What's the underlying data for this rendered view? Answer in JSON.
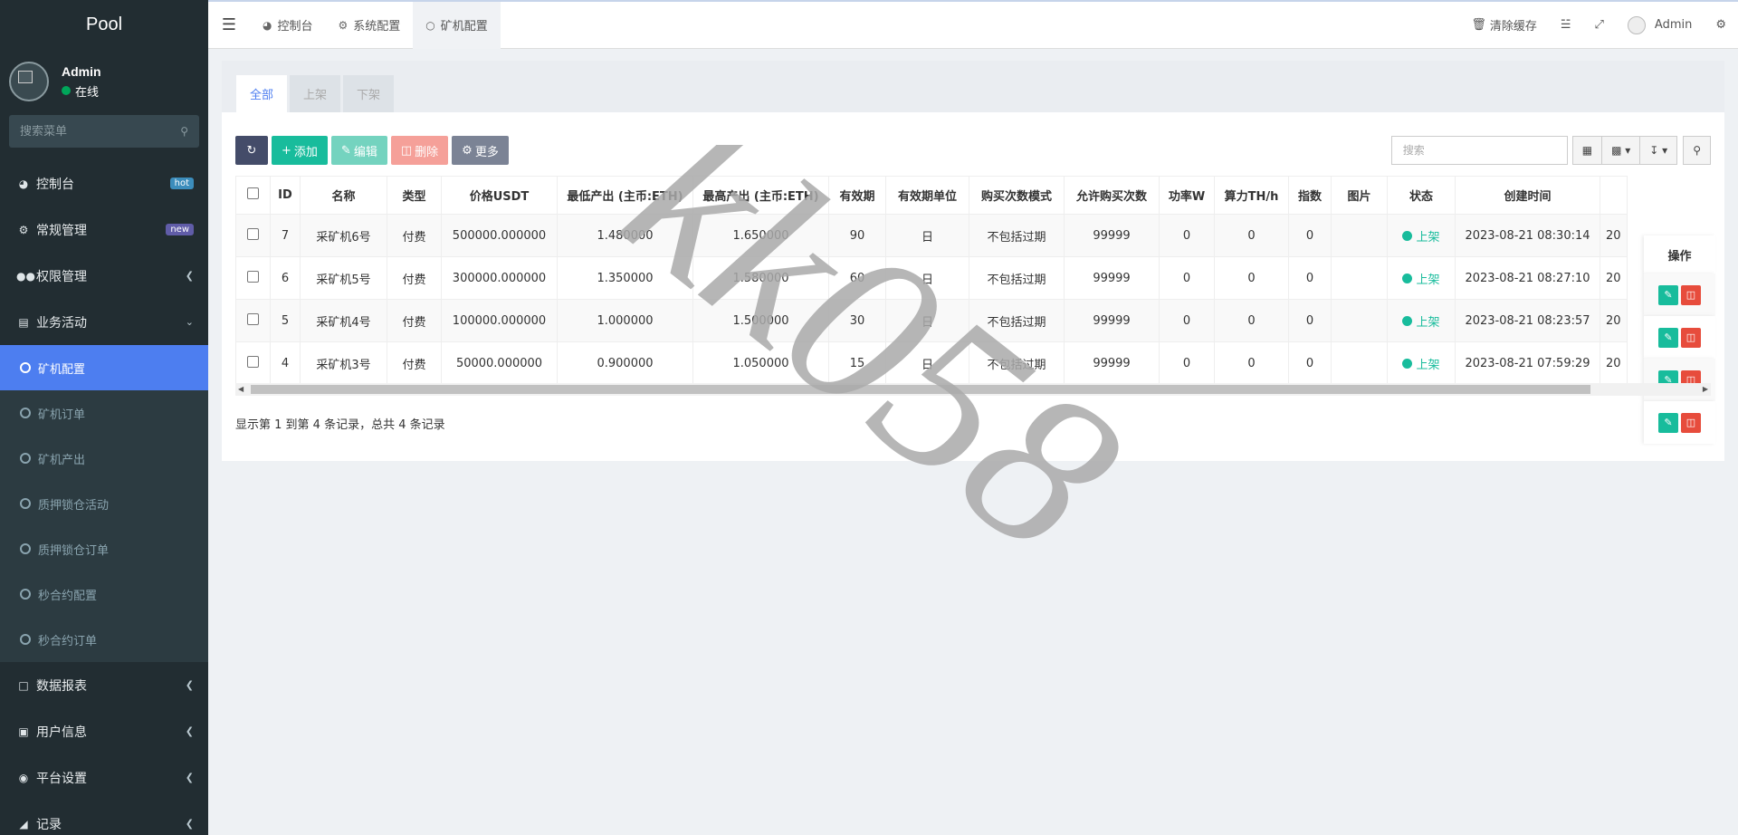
{
  "sidebar": {
    "logo": "Pool",
    "user": {
      "name": "Admin",
      "status": "在线"
    },
    "search_placeholder": "搜索菜单",
    "items": [
      {
        "label": "控制台",
        "badge": "hot",
        "icon": "dashboard-icon"
      },
      {
        "label": "常规管理",
        "badge": "new",
        "icon": "cogs-icon"
      },
      {
        "label": "权限管理",
        "icon": "group-icon"
      },
      {
        "label": "业务活动",
        "icon": "list-alt-icon"
      }
    ],
    "sub_items": [
      "矿机配置",
      "矿机订单",
      "矿机产出",
      "质押锁仓活动",
      "质押锁仓订单",
      "秒合约配置",
      "秒合约订单"
    ],
    "bottom_items": [
      {
        "label": "数据报表",
        "icon": "file-icon"
      },
      {
        "label": "用户信息",
        "icon": "user-card-icon"
      },
      {
        "label": "平台设置",
        "icon": "dot-circle-icon"
      },
      {
        "label": "记录",
        "icon": "area-chart-icon"
      }
    ]
  },
  "header": {
    "tabs": [
      {
        "label": "控制台",
        "icon": "dashboard-icon"
      },
      {
        "label": "系统配置",
        "icon": "gear-icon"
      },
      {
        "label": "矿机配置",
        "icon": "circle-icon"
      }
    ],
    "clear_cache": "清除缓存",
    "user": "Admin"
  },
  "content": {
    "subtabs": [
      "全部",
      "上架",
      "下架"
    ],
    "toolbar": {
      "add": "添加",
      "edit": "编辑",
      "delete": "删除",
      "more": "更多",
      "search_placeholder": "搜索"
    },
    "columns": [
      "ID",
      "名称",
      "类型",
      "价格USDT",
      "最低产出 (主币:ETH)",
      "最高产出 (主币:ETH)",
      "有效期",
      "有效期单位",
      "购买次数模式",
      "允许购买次数",
      "功率W",
      "算力TH/h",
      "指数",
      "图片",
      "状态",
      "创建时间",
      "操作"
    ],
    "rows": [
      [
        "7",
        "采矿机6号",
        "付费",
        "500000.000000",
        "1.480000",
        "1.650000",
        "90",
        "日",
        "不包括过期",
        "99999",
        "0",
        "0",
        "0",
        "",
        "上架",
        "2023-08-21 08:30:14",
        "20"
      ],
      [
        "6",
        "采矿机5号",
        "付费",
        "300000.000000",
        "1.350000",
        "1.580000",
        "60",
        "日",
        "不包括过期",
        "99999",
        "0",
        "0",
        "0",
        "",
        "上架",
        "2023-08-21 08:27:10",
        "20"
      ],
      [
        "5",
        "采矿机4号",
        "付费",
        "100000.000000",
        "1.000000",
        "1.500000",
        "30",
        "日",
        "不包括过期",
        "99999",
        "0",
        "0",
        "0",
        "",
        "上架",
        "2023-08-21 08:23:57",
        "20"
      ],
      [
        "4",
        "采矿机3号",
        "付费",
        "50000.000000",
        "0.900000",
        "1.050000",
        "15",
        "日",
        "不包括过期",
        "99999",
        "0",
        "0",
        "0",
        "",
        "上架",
        "2023-08-21 07:59:29",
        "20"
      ]
    ],
    "pager_text": "显示第 1 到第 4 条记录，总共 4 条记录"
  },
  "watermark": "kk058",
  "colors": {
    "sidebar_bg": "#222d32",
    "active": "#4d7ef0",
    "green": "#18bc9c",
    "red": "#e74c3c"
  }
}
